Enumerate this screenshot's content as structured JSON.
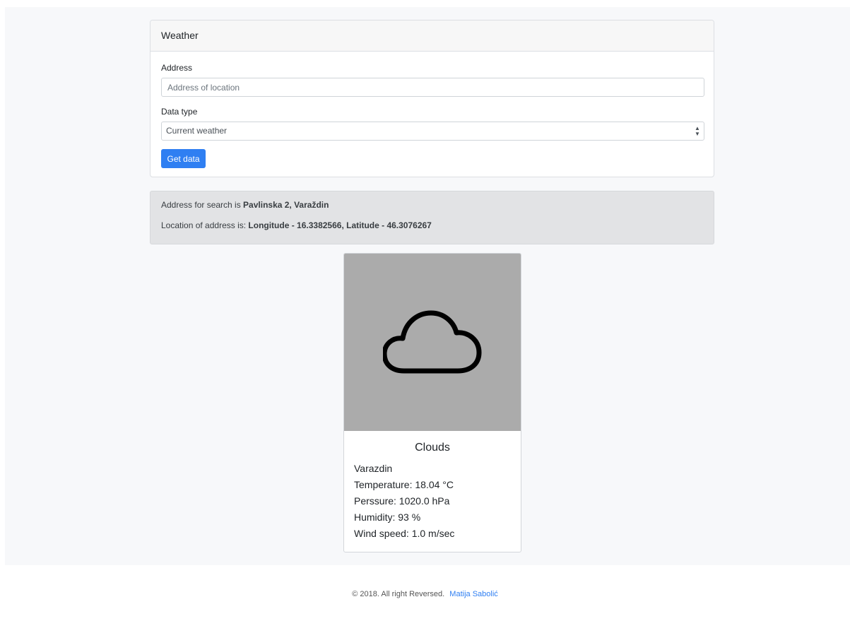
{
  "form": {
    "title": "Weather",
    "address_label": "Address",
    "address_placeholder": "Address of location",
    "address_value": "",
    "datatype_label": "Data type",
    "datatype_selected": "Current weather",
    "submit_label": "Get data"
  },
  "info": {
    "search_prefix": "Address for search is ",
    "search_address": "Pavlinska 2, Varaždin",
    "location_prefix": "Location of address is: ",
    "location_value": "Longitude - 16.3382566, Latitude - 46.3076267"
  },
  "weather": {
    "icon": "cloud-icon",
    "condition": "Clouds",
    "city": "Varazdin",
    "temperature": "Temperature: 18.04 °C",
    "pressure": "Perssure: 1020.0 hPa",
    "humidity": "Humidity: 93 %",
    "wind": "Wind speed: 1.0 m/sec"
  },
  "footer": {
    "copyright": "© 2018. All right Reversed.",
    "author_link": "Matija Sabolić"
  },
  "colors": {
    "primary": "#2f7ff2",
    "image_bg": "#ababab",
    "info_bg": "#e2e3e5"
  }
}
